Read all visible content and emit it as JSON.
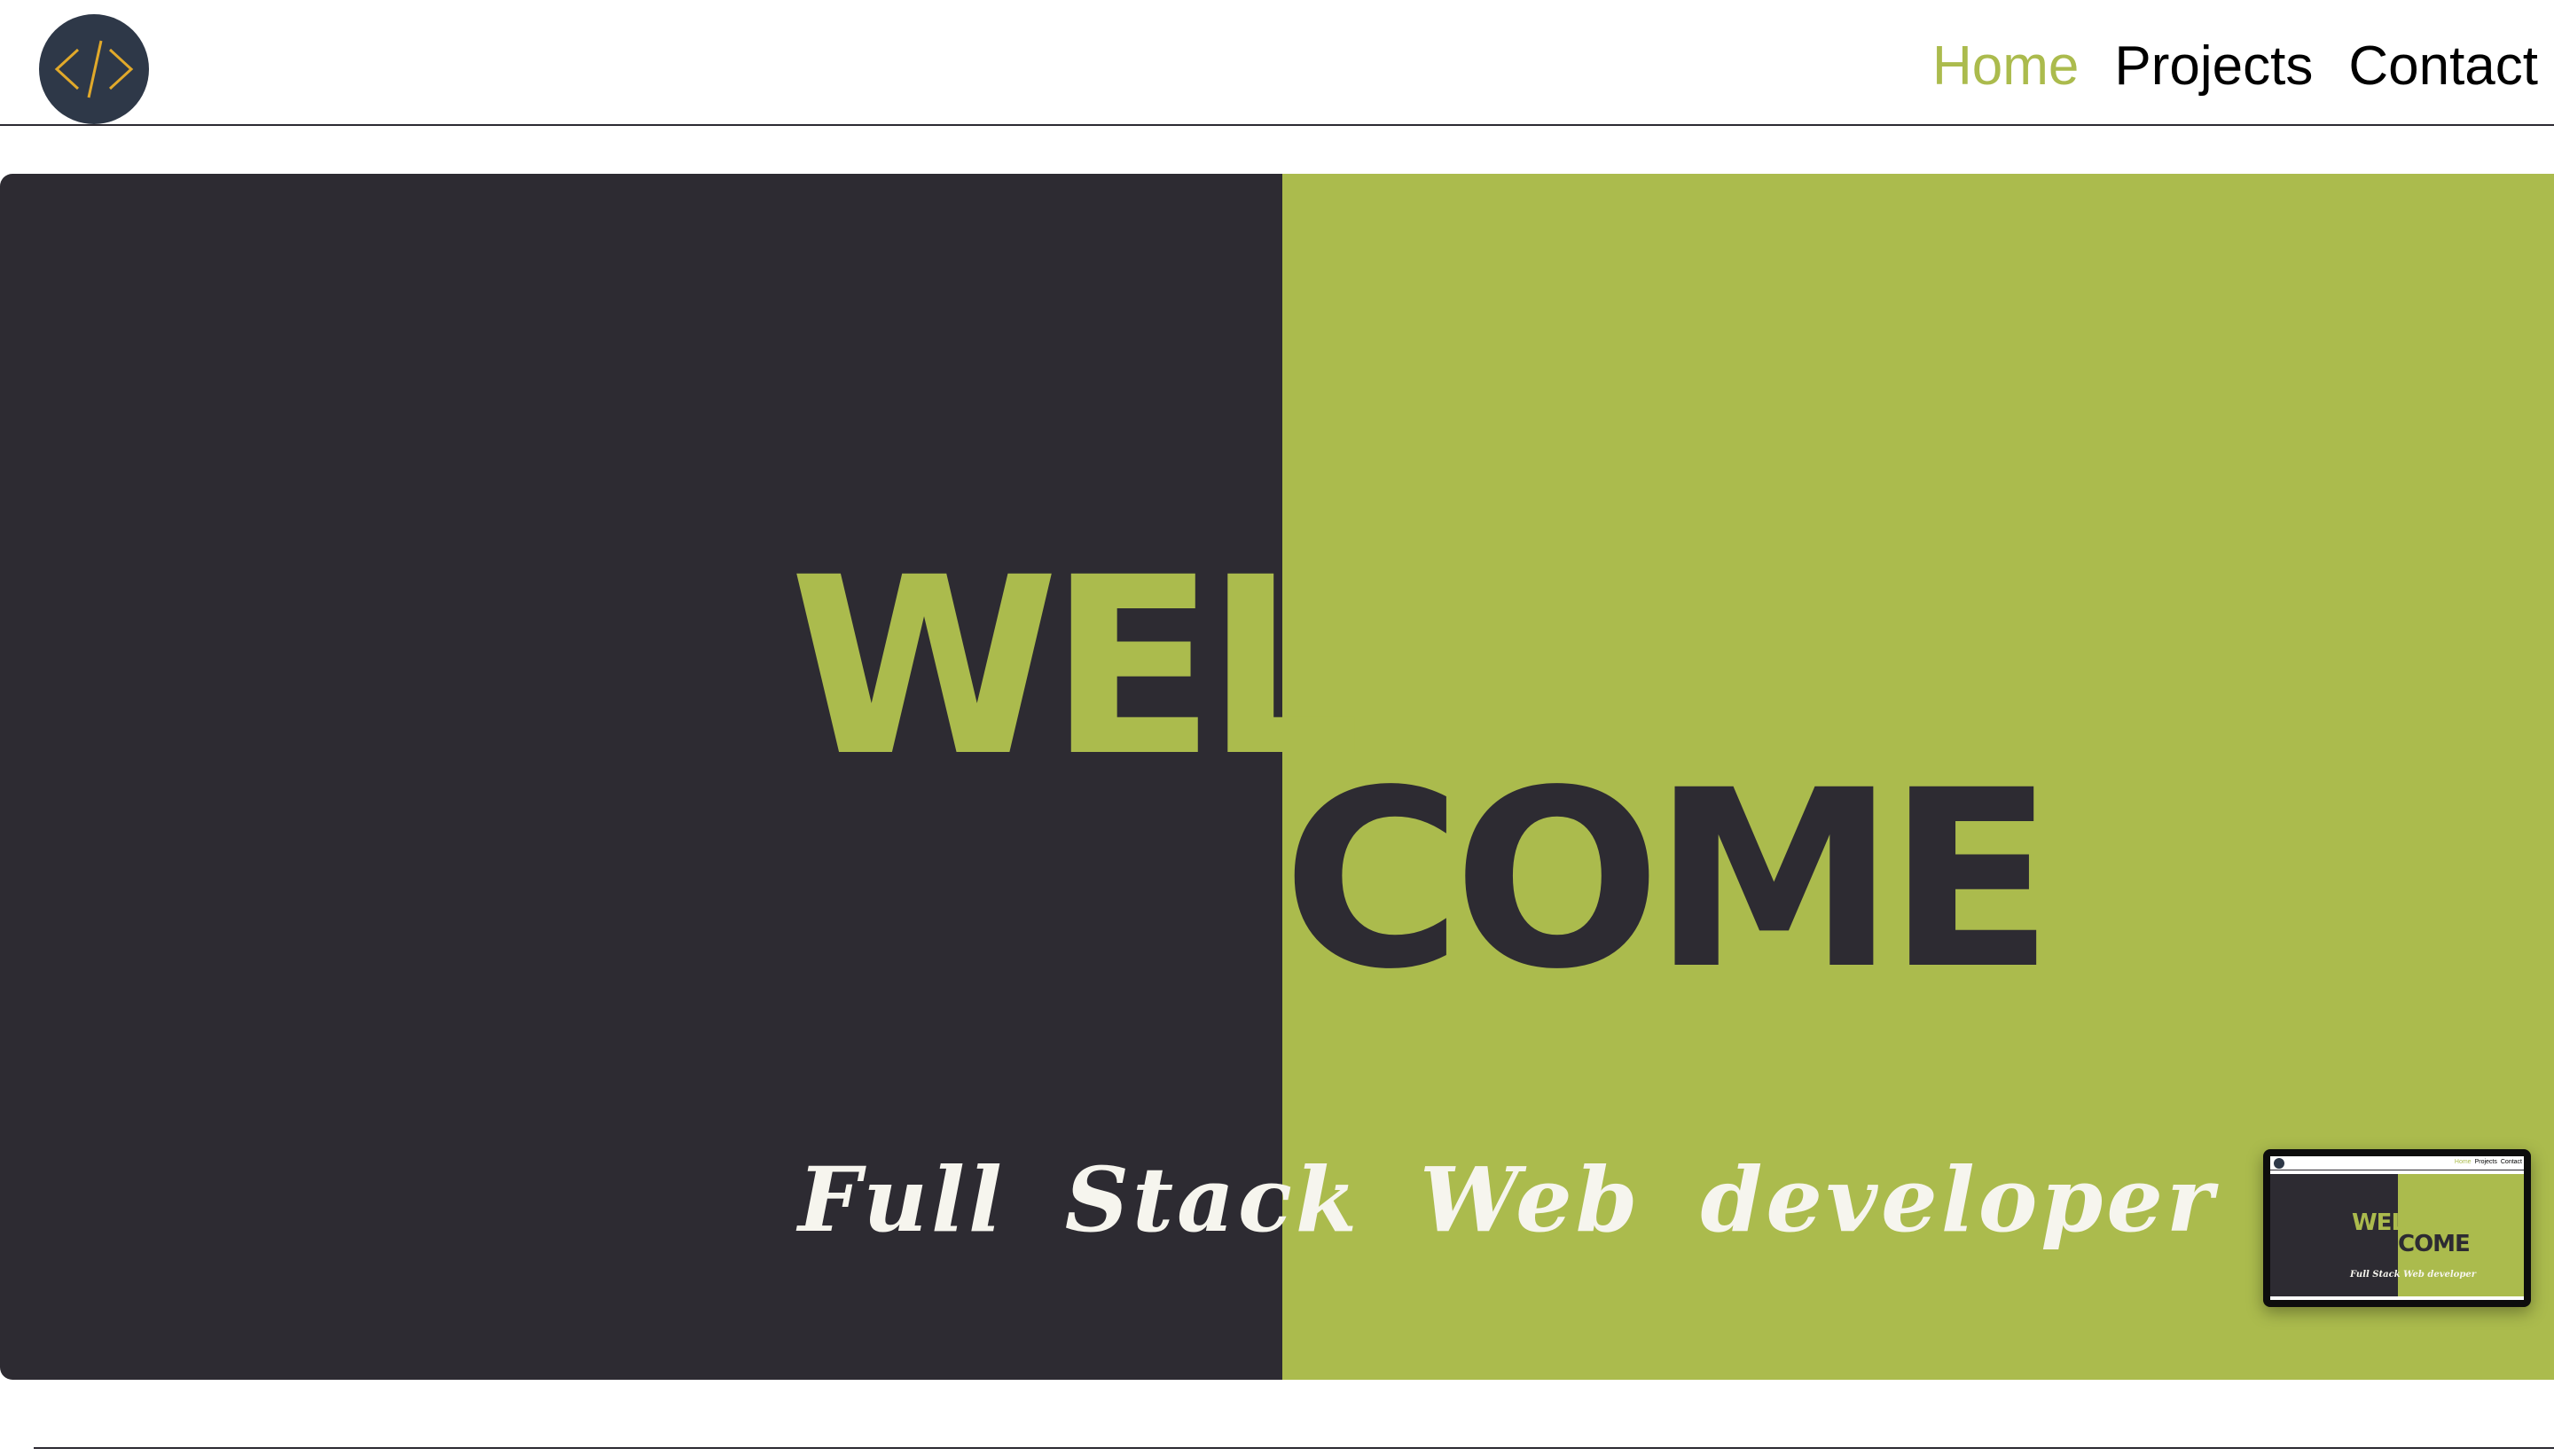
{
  "colors": {
    "accent": "#abbb4d",
    "dark": "#2d2b32",
    "logo_bg": "#2e3848",
    "logo_glyph": "#e1a92a",
    "tagline": "#f6f5ee"
  },
  "header": {
    "logo_icon": "code-brackets-icon",
    "nav": [
      {
        "label": "Home",
        "active": true
      },
      {
        "label": "Projects",
        "active": false
      },
      {
        "label": "Contact",
        "active": false
      }
    ]
  },
  "hero": {
    "welcome_part1": "WEL",
    "welcome_part2": "COME",
    "tagline": "Full Stack Web developer"
  },
  "preview": {
    "nav": [
      "Home",
      "Projects",
      "Contact"
    ],
    "welcome_part1": "WEL",
    "welcome_part2": "COME",
    "tagline": "Full Stack Web developer"
  }
}
